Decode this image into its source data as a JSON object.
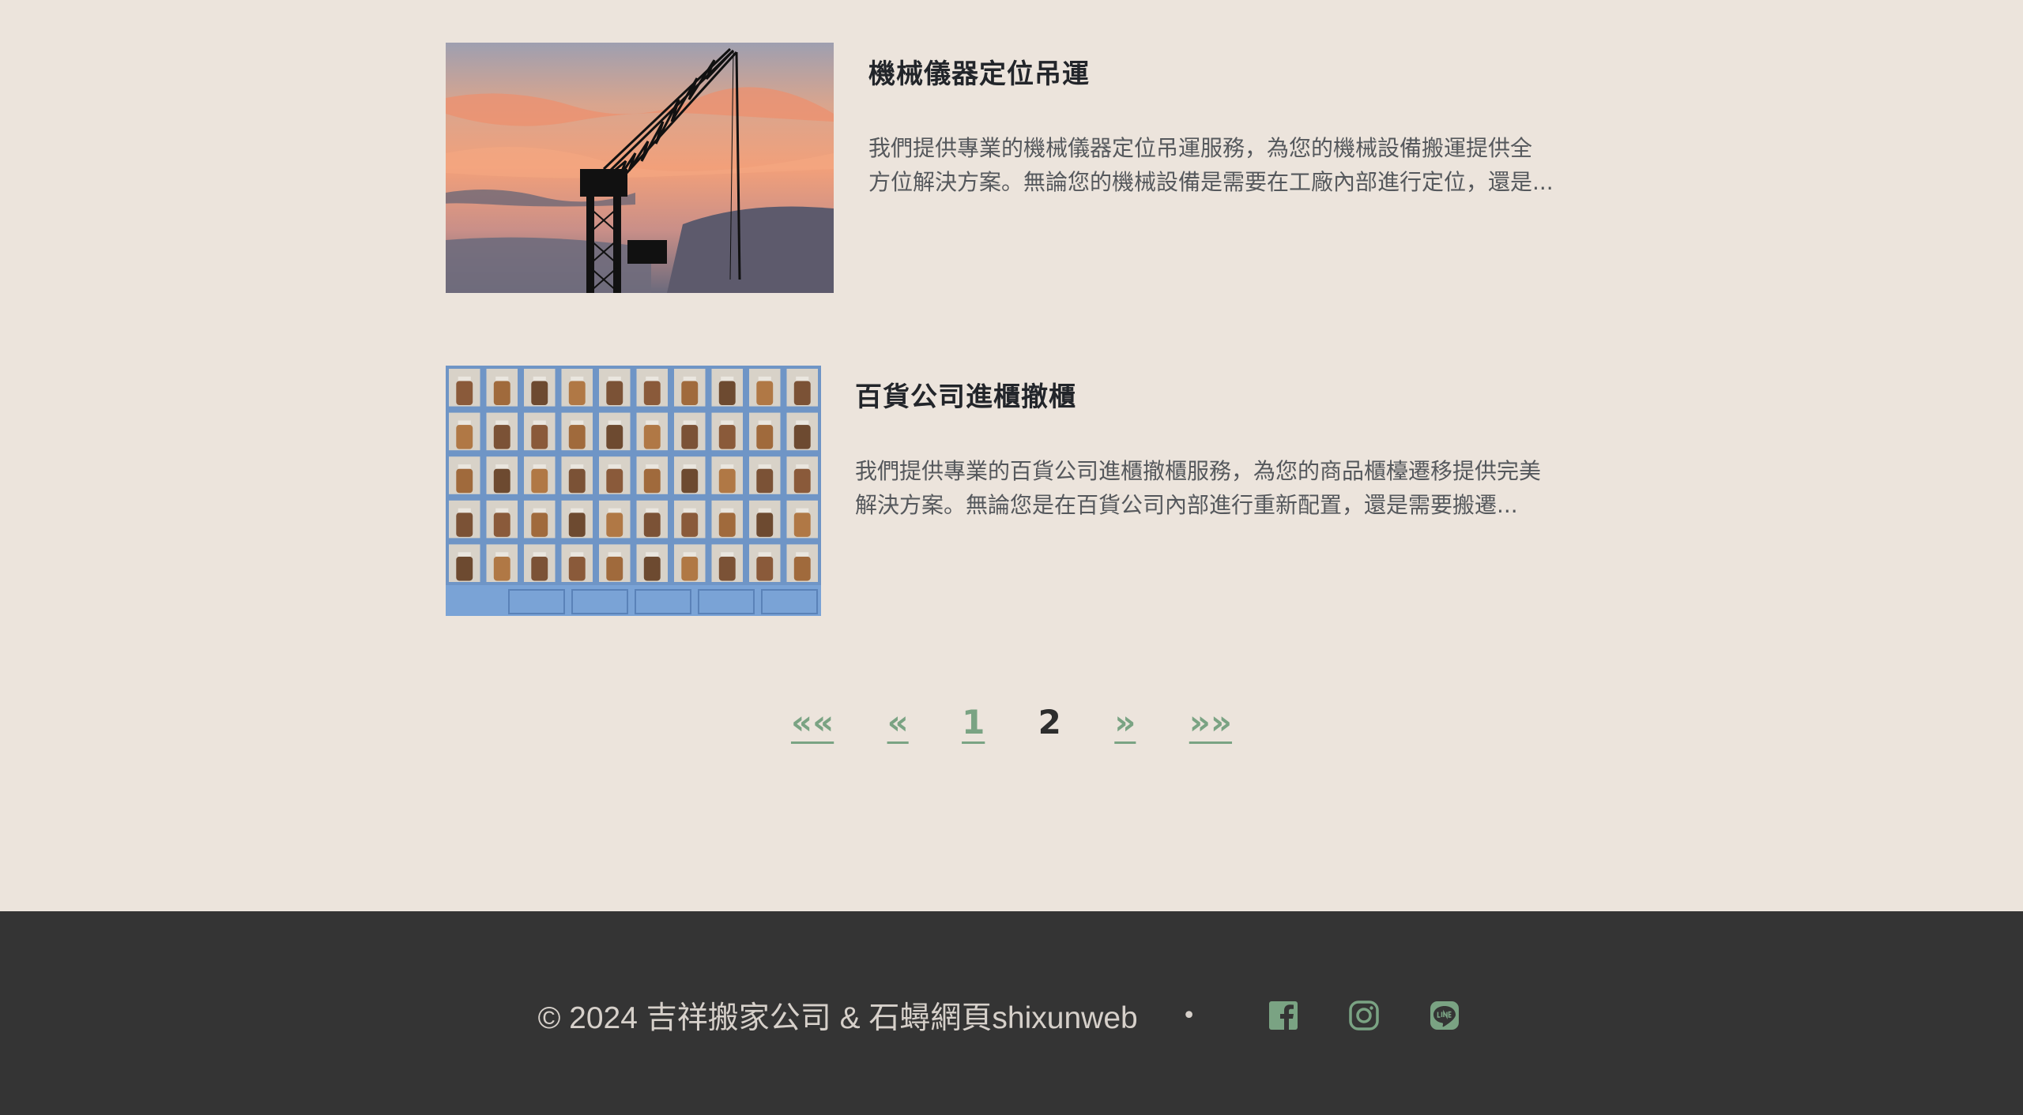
{
  "posts": [
    {
      "title": "機械儀器定位吊運",
      "excerpt": "我們提供專業的機械儀器定位吊運服務，為您的機械設備搬運提供全\n方位解決方案。無論您的機械設備是需要在工廠內部進行定位，還是...",
      "image": "crane-at-sunset-photo"
    },
    {
      "title": "百貨公司進櫃撤櫃",
      "excerpt": "我們提供專業的百貨公司進櫃撤櫃服務，為您的商品櫃檯遷移提供完美\n解決方案。無論您是在百貨公司內部進行重新配置，還是需要搬遷...",
      "image": "display-shelves-with-jars-photo"
    }
  ],
  "pagination": {
    "first": "««",
    "prev": "«",
    "pages": [
      "1",
      "2"
    ],
    "current": "2",
    "next": "»",
    "last": "»»"
  },
  "footer": {
    "copyright": "© 2024 吉祥搬家公司 & 石蟳網頁shixunweb",
    "separator": "•",
    "social": [
      "facebook-icon",
      "instagram-icon",
      "line-icon"
    ]
  },
  "colors": {
    "background": "#ece4dc",
    "footer_bg": "#343434",
    "accent": "#7aa383",
    "title": "#22252a",
    "text": "#55585c"
  }
}
